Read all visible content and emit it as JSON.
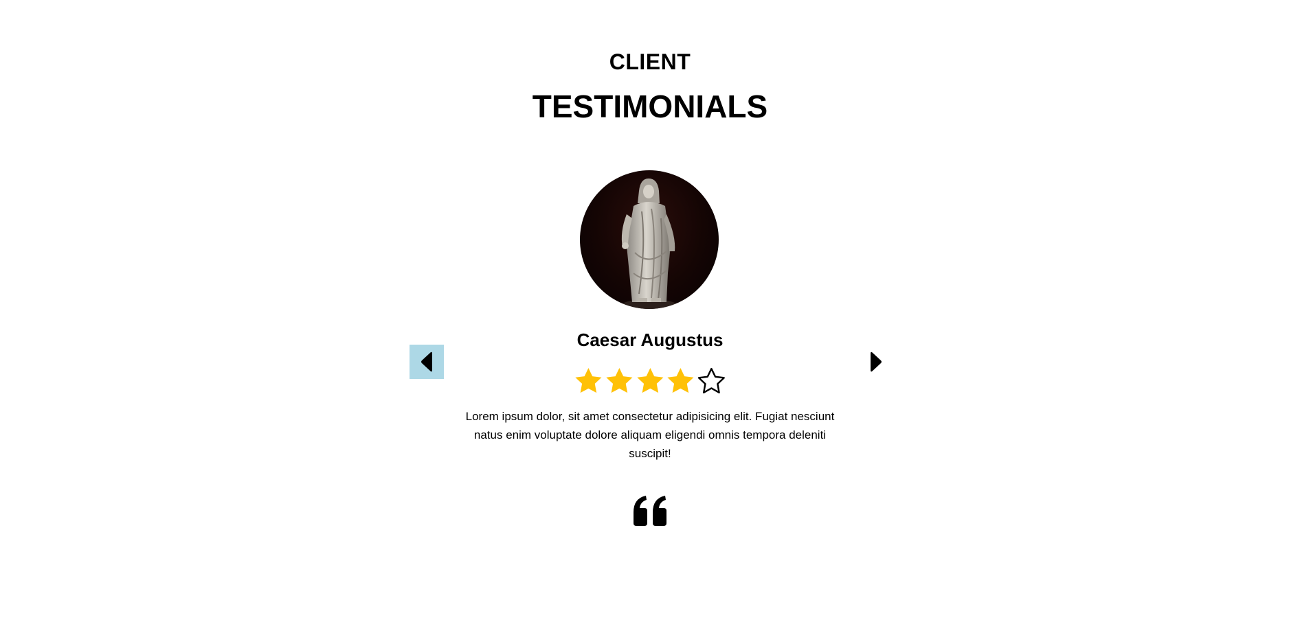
{
  "header": {
    "subtitle": "CLIENT",
    "title": "TESTIMONIALS"
  },
  "testimonial": {
    "name": "Caesar Augustus",
    "rating": 4,
    "rating_max": 5,
    "text": "Lorem ipsum dolor, sit amet consectetur adipisicing elit. Fugiat nesciunt natus enim voluptate dolore aliquam eligendi omnis tempora deleniti suscipit!"
  },
  "icons": {
    "prev": "caret-left-icon",
    "next": "caret-right-icon",
    "quote": "quote-left-icon",
    "star_filled": "star-filled-icon",
    "star_empty": "star-outline-icon"
  },
  "colors": {
    "star": "#FFC107",
    "prev_button_bg": "#ADD8E6"
  }
}
